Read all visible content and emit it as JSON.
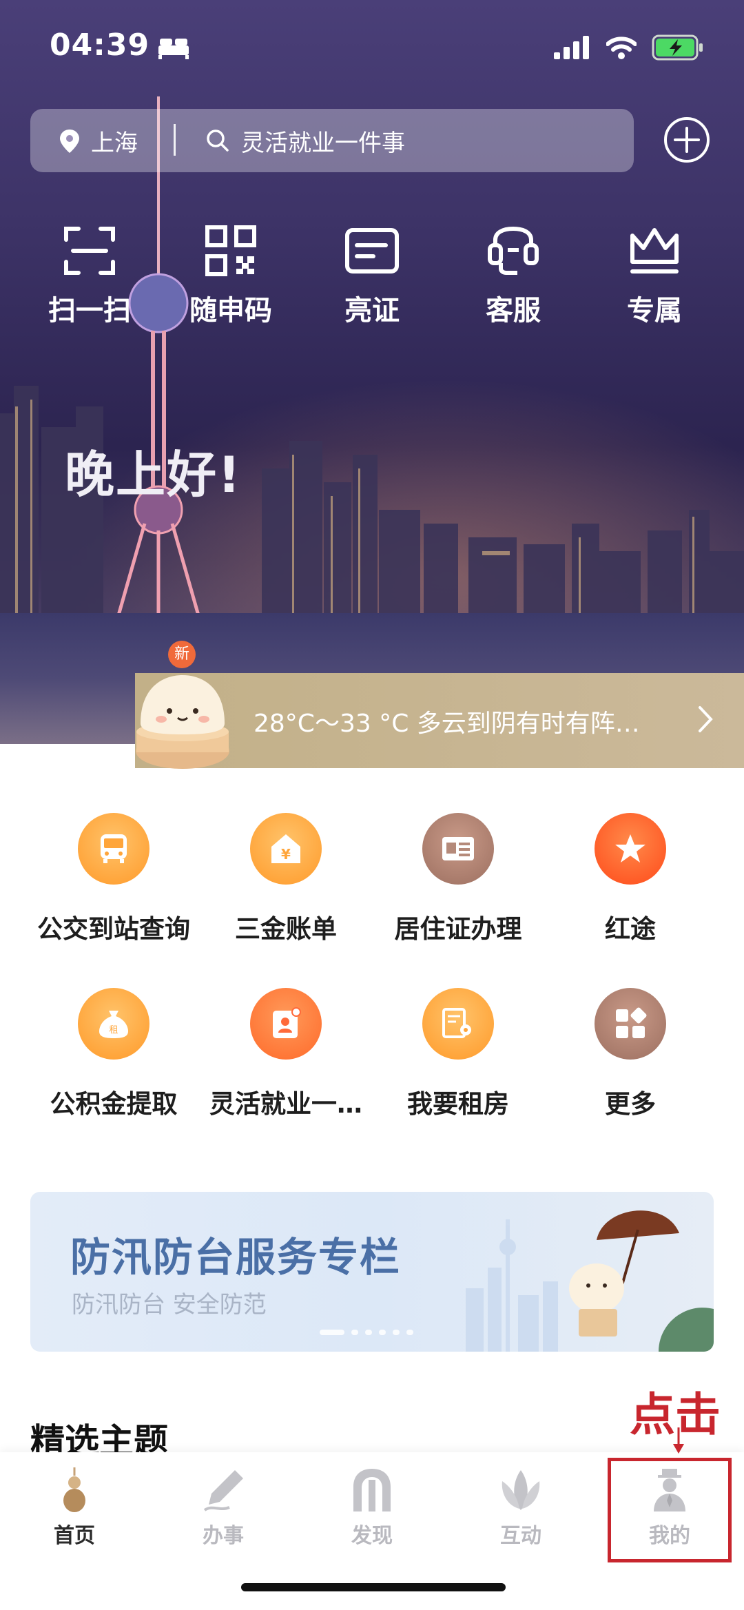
{
  "status_bar": {
    "time": "04:39"
  },
  "search": {
    "city": "上海",
    "placeholder": "灵活就业一件事"
  },
  "shortcuts": [
    {
      "label": "扫一扫",
      "icon": "scan-icon"
    },
    {
      "label": "随申码",
      "icon": "qr-code-icon"
    },
    {
      "label": "亮证",
      "icon": "card-icon"
    },
    {
      "label": "客服",
      "icon": "headset-icon"
    },
    {
      "label": "专属",
      "icon": "crown-icon"
    }
  ],
  "greeting": "晚上好!",
  "weather": {
    "badge": "新",
    "text": "28°C～33 °C 多云到阴有时有阵…"
  },
  "services": [
    {
      "label": "公交到站查询",
      "icon": "bus-icon",
      "color": "#ffa53a"
    },
    {
      "label": "三金账单",
      "icon": "house-yen-icon",
      "color": "#ffa53a"
    },
    {
      "label": "居住证办理",
      "icon": "residence-card-icon",
      "color": "#a87868"
    },
    {
      "label": "红途",
      "icon": "star-icon",
      "color": "#ff5a2a"
    },
    {
      "label": "公积金提取",
      "icon": "money-bag-icon",
      "color": "#ffa53a"
    },
    {
      "label": "灵活就业一…",
      "icon": "id-badge-icon",
      "color": "#ff6a3a"
    },
    {
      "label": "我要租房",
      "icon": "rent-document-icon",
      "color": "#ffa53a"
    },
    {
      "label": "更多",
      "icon": "grid-more-icon",
      "color": "#a87868"
    }
  ],
  "banner": {
    "title": "防汛防台服务专栏",
    "subtitle": "防汛防台 安全防范"
  },
  "section_title": "精选主题",
  "tabs": [
    {
      "label": "首页",
      "icon": "home-gourd-icon",
      "active": true
    },
    {
      "label": "办事",
      "icon": "pen-icon",
      "active": false
    },
    {
      "label": "发现",
      "icon": "arch-icon",
      "active": false
    },
    {
      "label": "互动",
      "icon": "magnolia-icon",
      "active": false
    },
    {
      "label": "我的",
      "icon": "profile-icon",
      "active": false
    }
  ],
  "annotation": {
    "text": "点击",
    "color": "#c8262e"
  }
}
